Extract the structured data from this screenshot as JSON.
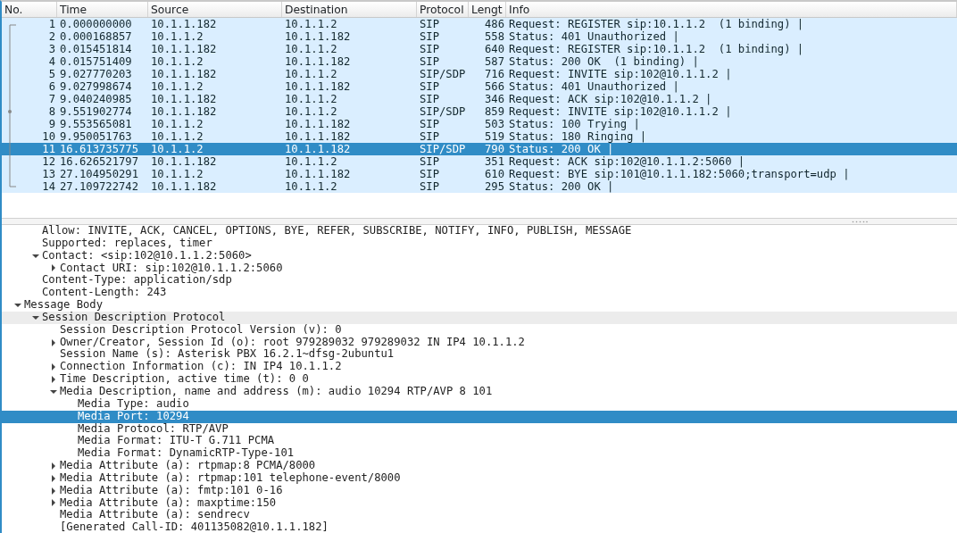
{
  "packet_list": {
    "columns": [
      "No.",
      "Time",
      "Source",
      "Destination",
      "Protocol",
      "Lengt",
      "Info"
    ],
    "rows": [
      {
        "cells": [
          "1",
          "0.000000000",
          "10.1.1.182",
          "10.1.1.2",
          "SIP",
          "486",
          "Request: REGISTER sip:10.1.1.2  (1 binding) |"
        ],
        "selected": false
      },
      {
        "cells": [
          "2",
          "0.000168857",
          "10.1.1.2",
          "10.1.1.182",
          "SIP",
          "558",
          "Status: 401 Unauthorized |"
        ],
        "selected": false
      },
      {
        "cells": [
          "3",
          "0.015451814",
          "10.1.1.182",
          "10.1.1.2",
          "SIP",
          "640",
          "Request: REGISTER sip:10.1.1.2  (1 binding) |"
        ],
        "selected": false
      },
      {
        "cells": [
          "4",
          "0.015751409",
          "10.1.1.2",
          "10.1.1.182",
          "SIP",
          "587",
          "Status: 200 OK  (1 binding) |"
        ],
        "selected": false
      },
      {
        "cells": [
          "5",
          "9.027770203",
          "10.1.1.182",
          "10.1.1.2",
          "SIP/SDP",
          "716",
          "Request: INVITE sip:102@10.1.1.2 |"
        ],
        "selected": false
      },
      {
        "cells": [
          "6",
          "9.027998674",
          "10.1.1.2",
          "10.1.1.182",
          "SIP",
          "566",
          "Status: 401 Unauthorized |"
        ],
        "selected": false
      },
      {
        "cells": [
          "7",
          "9.040240985",
          "10.1.1.182",
          "10.1.1.2",
          "SIP",
          "346",
          "Request: ACK sip:102@10.1.1.2 |"
        ],
        "selected": false
      },
      {
        "cells": [
          "8",
          "9.551902774",
          "10.1.1.182",
          "10.1.1.2",
          "SIP/SDP",
          "859",
          "Request: INVITE sip:102@10.1.1.2 |"
        ],
        "selected": false
      },
      {
        "cells": [
          "9",
          "9.553565081",
          "10.1.1.2",
          "10.1.1.182",
          "SIP",
          "503",
          "Status: 100 Trying |"
        ],
        "selected": false
      },
      {
        "cells": [
          "10",
          "9.950051763",
          "10.1.1.2",
          "10.1.1.182",
          "SIP",
          "519",
          "Status: 180 Ringing |"
        ],
        "selected": false
      },
      {
        "cells": [
          "11",
          "16.613735775",
          "10.1.1.2",
          "10.1.1.182",
          "SIP/SDP",
          "790",
          "Status: 200 OK |"
        ],
        "selected": true
      },
      {
        "cells": [
          "12",
          "16.626521797",
          "10.1.1.182",
          "10.1.1.2",
          "SIP",
          "351",
          "Request: ACK sip:102@10.1.1.2:5060 |"
        ],
        "selected": false
      },
      {
        "cells": [
          "13",
          "27.104950291",
          "10.1.1.2",
          "10.1.1.182",
          "SIP",
          "610",
          "Request: BYE sip:101@10.1.1.182:5060;transport=udp |"
        ],
        "selected": false
      },
      {
        "cells": [
          "14",
          "27.109722742",
          "10.1.1.182",
          "10.1.1.2",
          "SIP",
          "295",
          "Status: 200 OK |"
        ],
        "selected": false
      }
    ]
  },
  "details": {
    "items": [
      {
        "children": [
          {
            "label": "Allow: INVITE, ACK, CANCEL, OPTIONS, BYE, REFER, SUBSCRIBE, NOTIFY, INFO, PUBLISH, MESSAGE",
            "selected": false,
            "hovered": false
          },
          {
            "label": "Supported: replaces, timer",
            "selected": false,
            "hovered": false
          },
          {
            "label": "Contact: <sip:102@10.1.1.2:5060>",
            "expanded": true,
            "selected": false,
            "hovered": false,
            "children": [
              {
                "label": "Contact URI: sip:102@10.1.1.2:5060",
                "expanded": false,
                "selected": false,
                "hovered": false
              }
            ]
          },
          {
            "label": "Content-Type: application/sdp",
            "selected": false,
            "hovered": false
          },
          {
            "label": "Content-Length: 243",
            "selected": false,
            "hovered": false
          }
        ]
      },
      {
        "label": "Message Body",
        "expanded": true,
        "selected": false,
        "hovered": false,
        "children": [
          {
            "label": "Session Description Protocol",
            "expanded": true,
            "selected": false,
            "hovered": true,
            "children": [
              {
                "label": "Session Description Protocol Version (v): 0",
                "selected": false,
                "hovered": false
              },
              {
                "label": "Owner/Creator, Session Id (o): root 979289032 979289032 IN IP4 10.1.1.2",
                "expanded": false,
                "selected": false,
                "hovered": false
              },
              {
                "label": "Session Name (s): Asterisk PBX 16.2.1~dfsg-2ubuntu1",
                "selected": false,
                "hovered": false
              },
              {
                "label": "Connection Information (c): IN IP4 10.1.1.2",
                "expanded": false,
                "selected": false,
                "hovered": false
              },
              {
                "label": "Time Description, active time (t): 0 0",
                "expanded": false,
                "selected": false,
                "hovered": false
              },
              {
                "label": "Media Description, name and address (m): audio 10294 RTP/AVP 8 101",
                "expanded": true,
                "selected": false,
                "hovered": false,
                "children": [
                  {
                    "label": "Media Type: audio",
                    "selected": false,
                    "hovered": false
                  },
                  {
                    "label": "Media Port: 10294",
                    "selected": true,
                    "hovered": false
                  },
                  {
                    "label": "Media Protocol: RTP/AVP",
                    "selected": false,
                    "hovered": false
                  },
                  {
                    "label": "Media Format: ITU-T G.711 PCMA",
                    "selected": false,
                    "hovered": false
                  },
                  {
                    "label": "Media Format: DynamicRTP-Type-101",
                    "selected": false,
                    "hovered": false
                  }
                ]
              },
              {
                "label": "Media Attribute (a): rtpmap:8 PCMA/8000",
                "expanded": false,
                "selected": false,
                "hovered": false
              },
              {
                "label": "Media Attribute (a): rtpmap:101 telephone-event/8000",
                "expanded": false,
                "selected": false,
                "hovered": false
              },
              {
                "label": "Media Attribute (a): fmtp:101 0-16",
                "expanded": false,
                "selected": false,
                "hovered": false
              },
              {
                "label": "Media Attribute (a): maxptime:150",
                "expanded": false,
                "selected": false,
                "hovered": false
              },
              {
                "label": "Media Attribute (a): sendrecv",
                "selected": false,
                "hovered": false
              },
              {
                "label": "[Generated Call-ID: 401135082@10.1.1.182]",
                "selected": false,
                "hovered": false
              }
            ]
          }
        ]
      }
    ]
  }
}
